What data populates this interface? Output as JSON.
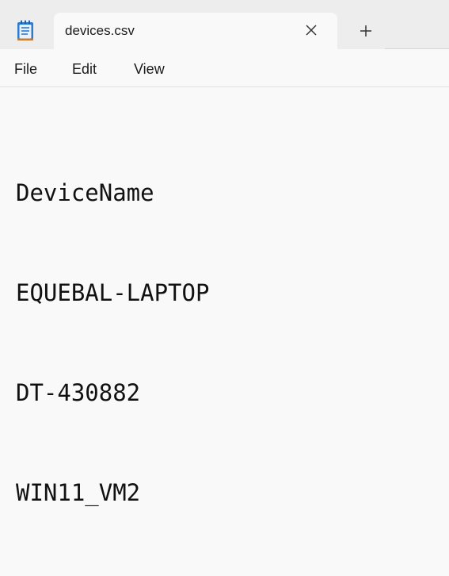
{
  "window": {
    "tab_title": "devices.csv",
    "icons": {
      "app": "notepad-icon",
      "close": "close-icon",
      "new_tab": "plus-icon"
    }
  },
  "menu": {
    "items": [
      "File",
      "Edit",
      "View"
    ]
  },
  "editor": {
    "lines": [
      "DeviceName",
      "EQUEBAL-LAPTOP",
      "DT-430882",
      "WIN11_VM2"
    ]
  },
  "colors": {
    "titlebar_bg": "#ededed",
    "content_bg": "#f9f9f9",
    "icon_blue": "#2b7bd1",
    "text": "#111111"
  }
}
